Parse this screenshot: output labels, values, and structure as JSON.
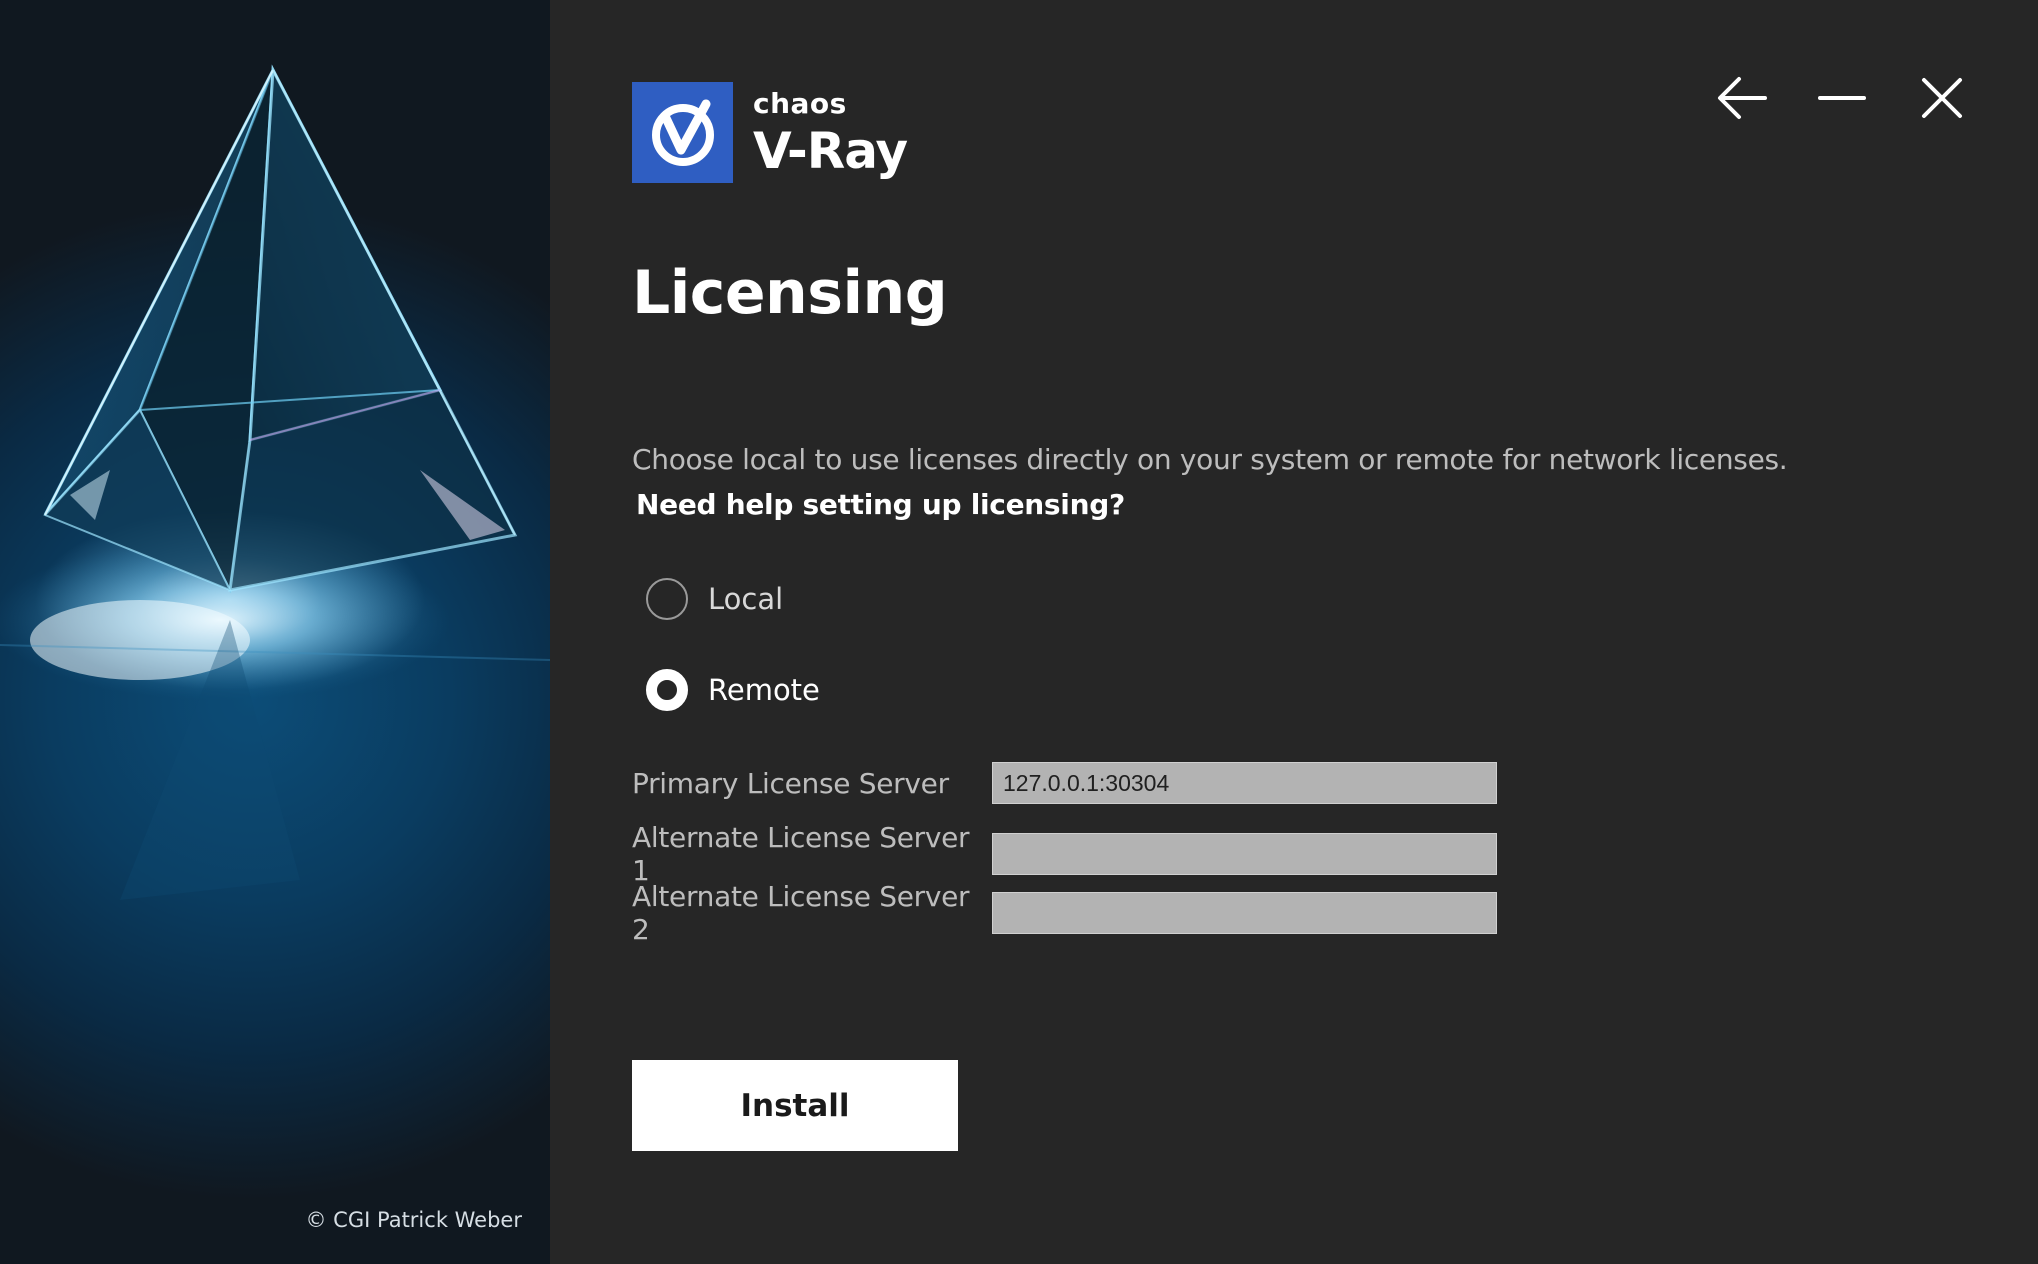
{
  "window": {
    "controls": {
      "back_icon": "arrow-left-icon",
      "minimize_icon": "minimize-icon",
      "close_icon": "close-icon"
    }
  },
  "art_panel": {
    "copyright": "© CGI Patrick Weber"
  },
  "logo": {
    "brand": "chaos",
    "product": "V-Ray",
    "mark_color": "#2f5ec2"
  },
  "page": {
    "title": "Licensing",
    "description": "Choose local to use licenses directly on your system or remote for network licenses.",
    "help_link": "Need help setting up licensing?"
  },
  "license_mode": {
    "options": [
      {
        "label": "Local",
        "selected": false
      },
      {
        "label": "Remote",
        "selected": true
      }
    ]
  },
  "servers": {
    "primary_label": "Primary License Server",
    "primary_value": "127.0.0.1:30304",
    "alt1_label": "Alternate License Server 1",
    "alt1_value": "",
    "alt2_label": "Alternate License Server 2",
    "alt2_value": ""
  },
  "actions": {
    "install_label": "Install"
  }
}
